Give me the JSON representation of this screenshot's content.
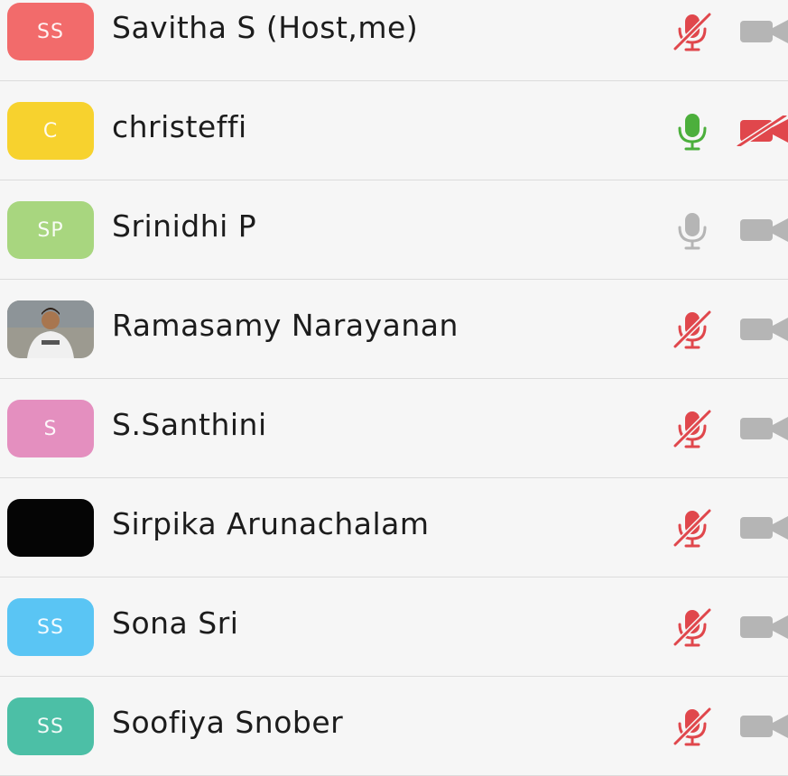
{
  "colors": {
    "muted_red": "#e0474c",
    "active_green": "#4caf3c",
    "idle_gray": "#b5b5b5"
  },
  "participants": [
    {
      "initials": "SS",
      "name": "Savitha S (Host,me)",
      "avatar_color": "#f26b6b",
      "mic": "muted",
      "camera": "off"
    },
    {
      "initials": "C",
      "name": "christeffi",
      "avatar_color": "#f7d22e",
      "mic": "on",
      "camera": "disabled"
    },
    {
      "initials": "SP",
      "name": "Srinidhi P",
      "avatar_color": "#a8d67f",
      "mic": "idle",
      "camera": "off"
    },
    {
      "initials": "",
      "name": "Ramasamy Narayanan",
      "avatar_color": "#9a9a9a",
      "avatar_type": "photo",
      "mic": "muted",
      "camera": "off"
    },
    {
      "initials": "S",
      "name": "S.Santhini",
      "avatar_color": "#e48fbf",
      "mic": "muted",
      "camera": "off"
    },
    {
      "initials": "",
      "name": "Sirpika Arunachalam",
      "avatar_color": "#050505",
      "mic": "muted",
      "camera": "off"
    },
    {
      "initials": "SS",
      "name": "Sona Sri",
      "avatar_color": "#5ac5f4",
      "mic": "muted",
      "camera": "off"
    },
    {
      "initials": "SS",
      "name": "Soofiya Snober",
      "avatar_color": "#4cbfa6",
      "mic": "muted",
      "camera": "off"
    }
  ]
}
